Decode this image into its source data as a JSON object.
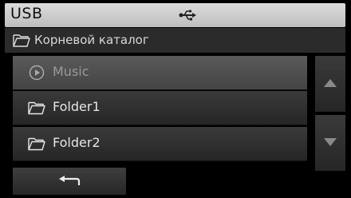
{
  "header": {
    "title": "USB",
    "icon": "usb-icon"
  },
  "path": {
    "label": "Корневой каталог",
    "icon": "folder-icon"
  },
  "list": {
    "items": [
      {
        "label": "Music",
        "icon": "play-circle-icon",
        "state": "playing"
      },
      {
        "label": "Folder1",
        "icon": "folder-icon"
      },
      {
        "label": "Folder2",
        "icon": "folder-icon"
      }
    ]
  },
  "controls": {
    "scroll_up_icon": "triangle-up-icon",
    "scroll_down_icon": "triangle-down-icon",
    "back_icon": "return-arrow-icon"
  }
}
